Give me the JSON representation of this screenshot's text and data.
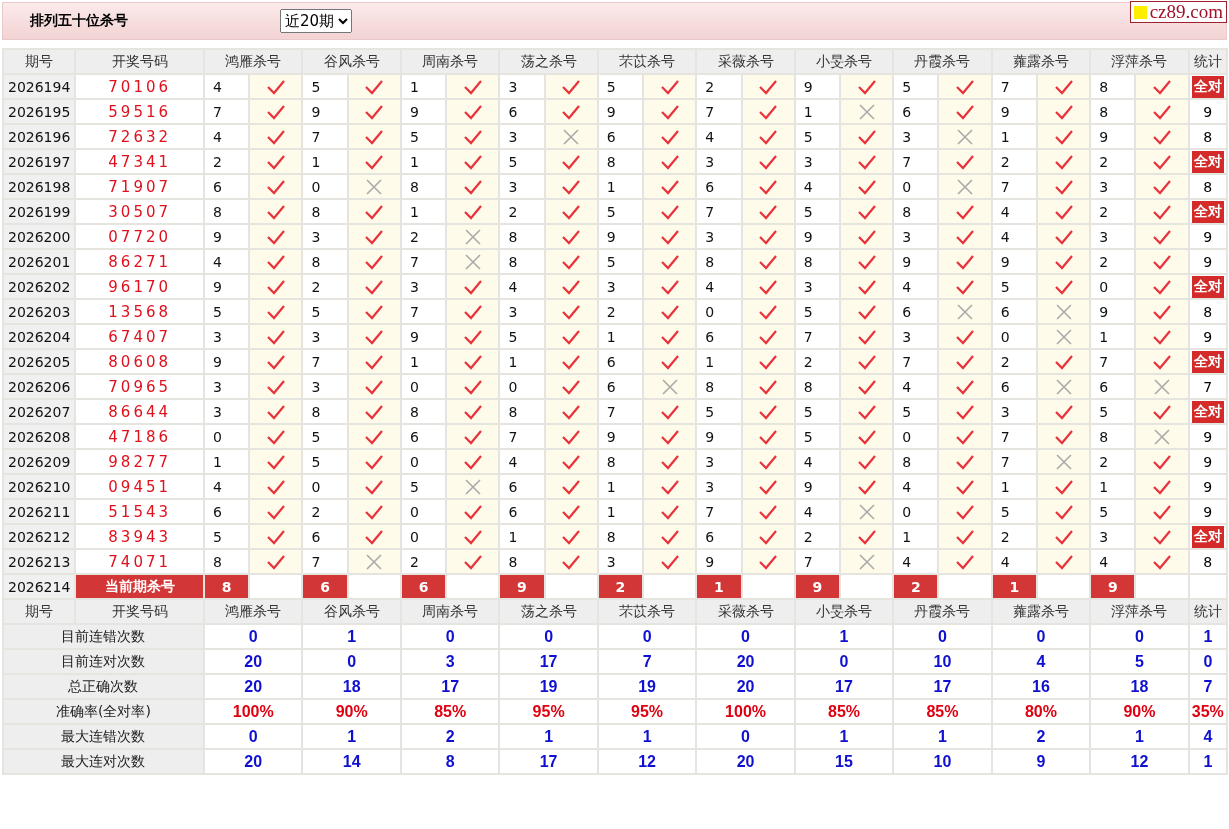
{
  "header": {
    "title": "排列五十位杀号",
    "period_select": "近20期",
    "logo": "cz89.com"
  },
  "columns": [
    "期号",
    "开奖号码",
    "鸿雁杀号",
    "谷风杀号",
    "周南杀号",
    "荡之杀号",
    "芣苡杀号",
    "采薇杀号",
    "小旻杀号",
    "丹霞杀号",
    "蕹露杀号",
    "浮萍杀号",
    "统计"
  ],
  "rows": [
    {
      "period": "2026194",
      "draw": "70106",
      "picks": [
        [
          "4",
          true
        ],
        [
          "5",
          true
        ],
        [
          "1",
          true
        ],
        [
          "3",
          true
        ],
        [
          "5",
          true
        ],
        [
          "2",
          true
        ],
        [
          "9",
          true
        ],
        [
          "5",
          true
        ],
        [
          "7",
          true
        ],
        [
          "8",
          true
        ]
      ],
      "stat": "全对",
      "full": true
    },
    {
      "period": "2026195",
      "draw": "59516",
      "picks": [
        [
          "7",
          true
        ],
        [
          "9",
          true
        ],
        [
          "9",
          true
        ],
        [
          "6",
          true
        ],
        [
          "9",
          true
        ],
        [
          "7",
          true
        ],
        [
          "1",
          false
        ],
        [
          "6",
          true
        ],
        [
          "9",
          true
        ],
        [
          "8",
          true
        ]
      ],
      "stat": "9",
      "full": false
    },
    {
      "period": "2026196",
      "draw": "72632",
      "picks": [
        [
          "4",
          true
        ],
        [
          "7",
          true
        ],
        [
          "5",
          true
        ],
        [
          "3",
          false
        ],
        [
          "6",
          true
        ],
        [
          "4",
          true
        ],
        [
          "5",
          true
        ],
        [
          "3",
          false
        ],
        [
          "1",
          true
        ],
        [
          "9",
          true
        ]
      ],
      "stat": "8",
      "full": false
    },
    {
      "period": "2026197",
      "draw": "47341",
      "picks": [
        [
          "2",
          true
        ],
        [
          "1",
          true
        ],
        [
          "1",
          true
        ],
        [
          "5",
          true
        ],
        [
          "8",
          true
        ],
        [
          "3",
          true
        ],
        [
          "3",
          true
        ],
        [
          "7",
          true
        ],
        [
          "2",
          true
        ],
        [
          "2",
          true
        ]
      ],
      "stat": "全对",
      "full": true
    },
    {
      "period": "2026198",
      "draw": "71907",
      "picks": [
        [
          "6",
          true
        ],
        [
          "0",
          false
        ],
        [
          "8",
          true
        ],
        [
          "3",
          true
        ],
        [
          "1",
          true
        ],
        [
          "6",
          true
        ],
        [
          "4",
          true
        ],
        [
          "0",
          false
        ],
        [
          "7",
          true
        ],
        [
          "3",
          true
        ]
      ],
      "stat": "8",
      "full": false
    },
    {
      "period": "2026199",
      "draw": "30507",
      "picks": [
        [
          "8",
          true
        ],
        [
          "8",
          true
        ],
        [
          "1",
          true
        ],
        [
          "2",
          true
        ],
        [
          "5",
          true
        ],
        [
          "7",
          true
        ],
        [
          "5",
          true
        ],
        [
          "8",
          true
        ],
        [
          "4",
          true
        ],
        [
          "2",
          true
        ]
      ],
      "stat": "全对",
      "full": true
    },
    {
      "period": "2026200",
      "draw": "07720",
      "picks": [
        [
          "9",
          true
        ],
        [
          "3",
          true
        ],
        [
          "2",
          false
        ],
        [
          "8",
          true
        ],
        [
          "9",
          true
        ],
        [
          "3",
          true
        ],
        [
          "9",
          true
        ],
        [
          "3",
          true
        ],
        [
          "4",
          true
        ],
        [
          "3",
          true
        ]
      ],
      "stat": "9",
      "full": false
    },
    {
      "period": "2026201",
      "draw": "86271",
      "picks": [
        [
          "4",
          true
        ],
        [
          "8",
          true
        ],
        [
          "7",
          false
        ],
        [
          "8",
          true
        ],
        [
          "5",
          true
        ],
        [
          "8",
          true
        ],
        [
          "8",
          true
        ],
        [
          "9",
          true
        ],
        [
          "9",
          true
        ],
        [
          "2",
          true
        ]
      ],
      "stat": "9",
      "full": false
    },
    {
      "period": "2026202",
      "draw": "96170",
      "picks": [
        [
          "9",
          true
        ],
        [
          "2",
          true
        ],
        [
          "3",
          true
        ],
        [
          "4",
          true
        ],
        [
          "3",
          true
        ],
        [
          "4",
          true
        ],
        [
          "3",
          true
        ],
        [
          "4",
          true
        ],
        [
          "5",
          true
        ],
        [
          "0",
          true
        ]
      ],
      "stat": "全对",
      "full": true
    },
    {
      "period": "2026203",
      "draw": "13568",
      "picks": [
        [
          "5",
          true
        ],
        [
          "5",
          true
        ],
        [
          "7",
          true
        ],
        [
          "3",
          true
        ],
        [
          "2",
          true
        ],
        [
          "0",
          true
        ],
        [
          "5",
          true
        ],
        [
          "6",
          false
        ],
        [
          "6",
          false
        ],
        [
          "9",
          true
        ]
      ],
      "stat": "8",
      "full": false
    },
    {
      "period": "2026204",
      "draw": "67407",
      "picks": [
        [
          "3",
          true
        ],
        [
          "3",
          true
        ],
        [
          "9",
          true
        ],
        [
          "5",
          true
        ],
        [
          "1",
          true
        ],
        [
          "6",
          true
        ],
        [
          "7",
          true
        ],
        [
          "3",
          true
        ],
        [
          "0",
          false
        ],
        [
          "1",
          true
        ]
      ],
      "stat": "9",
      "full": false
    },
    {
      "period": "2026205",
      "draw": "80608",
      "picks": [
        [
          "9",
          true
        ],
        [
          "7",
          true
        ],
        [
          "1",
          true
        ],
        [
          "1",
          true
        ],
        [
          "6",
          true
        ],
        [
          "1",
          true
        ],
        [
          "2",
          true
        ],
        [
          "7",
          true
        ],
        [
          "2",
          true
        ],
        [
          "7",
          true
        ]
      ],
      "stat": "全对",
      "full": true
    },
    {
      "period": "2026206",
      "draw": "70965",
      "picks": [
        [
          "3",
          true
        ],
        [
          "3",
          true
        ],
        [
          "0",
          true
        ],
        [
          "0",
          true
        ],
        [
          "6",
          false
        ],
        [
          "8",
          true
        ],
        [
          "8",
          true
        ],
        [
          "4",
          true
        ],
        [
          "6",
          false
        ],
        [
          "6",
          false
        ]
      ],
      "stat": "7",
      "full": false
    },
    {
      "period": "2026207",
      "draw": "86644",
      "picks": [
        [
          "3",
          true
        ],
        [
          "8",
          true
        ],
        [
          "8",
          true
        ],
        [
          "8",
          true
        ],
        [
          "7",
          true
        ],
        [
          "5",
          true
        ],
        [
          "5",
          true
        ],
        [
          "5",
          true
        ],
        [
          "3",
          true
        ],
        [
          "5",
          true
        ]
      ],
      "stat": "全对",
      "full": true
    },
    {
      "period": "2026208",
      "draw": "47186",
      "picks": [
        [
          "0",
          true
        ],
        [
          "5",
          true
        ],
        [
          "6",
          true
        ],
        [
          "7",
          true
        ],
        [
          "9",
          true
        ],
        [
          "9",
          true
        ],
        [
          "5",
          true
        ],
        [
          "0",
          true
        ],
        [
          "7",
          true
        ],
        [
          "8",
          false
        ]
      ],
      "stat": "9",
      "full": false
    },
    {
      "period": "2026209",
      "draw": "98277",
      "picks": [
        [
          "1",
          true
        ],
        [
          "5",
          true
        ],
        [
          "0",
          true
        ],
        [
          "4",
          true
        ],
        [
          "8",
          true
        ],
        [
          "3",
          true
        ],
        [
          "4",
          true
        ],
        [
          "8",
          true
        ],
        [
          "7",
          false
        ],
        [
          "2",
          true
        ]
      ],
      "stat": "9",
      "full": false
    },
    {
      "period": "2026210",
      "draw": "09451",
      "picks": [
        [
          "4",
          true
        ],
        [
          "0",
          true
        ],
        [
          "5",
          false
        ],
        [
          "6",
          true
        ],
        [
          "1",
          true
        ],
        [
          "3",
          true
        ],
        [
          "9",
          true
        ],
        [
          "4",
          true
        ],
        [
          "1",
          true
        ],
        [
          "1",
          true
        ]
      ],
      "stat": "9",
      "full": false
    },
    {
      "period": "2026211",
      "draw": "51543",
      "picks": [
        [
          "6",
          true
        ],
        [
          "2",
          true
        ],
        [
          "0",
          true
        ],
        [
          "6",
          true
        ],
        [
          "1",
          true
        ],
        [
          "7",
          true
        ],
        [
          "4",
          false
        ],
        [
          "0",
          true
        ],
        [
          "5",
          true
        ],
        [
          "5",
          true
        ]
      ],
      "stat": "9",
      "full": false
    },
    {
      "period": "2026212",
      "draw": "83943",
      "picks": [
        [
          "5",
          true
        ],
        [
          "6",
          true
        ],
        [
          "0",
          true
        ],
        [
          "1",
          true
        ],
        [
          "8",
          true
        ],
        [
          "6",
          true
        ],
        [
          "2",
          true
        ],
        [
          "1",
          true
        ],
        [
          "2",
          true
        ],
        [
          "3",
          true
        ]
      ],
      "stat": "全对",
      "full": true
    },
    {
      "period": "2026213",
      "draw": "74071",
      "picks": [
        [
          "8",
          true
        ],
        [
          "7",
          false
        ],
        [
          "2",
          true
        ],
        [
          "8",
          true
        ],
        [
          "3",
          true
        ],
        [
          "9",
          true
        ],
        [
          "7",
          false
        ],
        [
          "4",
          true
        ],
        [
          "4",
          true
        ],
        [
          "4",
          true
        ]
      ],
      "stat": "8",
      "full": false
    }
  ],
  "current": {
    "period": "2026214",
    "label": "当前期杀号",
    "picks": [
      "8",
      "6",
      "6",
      "9",
      "2",
      "1",
      "9",
      "2",
      "1",
      "9"
    ]
  },
  "footer_columns": [
    "期号",
    "开奖号码",
    "鸿雁杀号",
    "谷风杀号",
    "周南杀号",
    "荡之杀号",
    "芣苡杀号",
    "采薇杀号",
    "小旻杀号",
    "丹霞杀号",
    "蕹露杀号",
    "浮萍杀号",
    "统计"
  ],
  "summary": [
    {
      "label": "目前连错次数",
      "kind": "count",
      "values": [
        "0",
        "1",
        "0",
        "0",
        "0",
        "0",
        "1",
        "0",
        "0",
        "0",
        "1"
      ]
    },
    {
      "label": "目前连对次数",
      "kind": "count",
      "values": [
        "20",
        "0",
        "3",
        "17",
        "7",
        "20",
        "0",
        "10",
        "4",
        "5",
        "0"
      ]
    },
    {
      "label": "总正确次数",
      "kind": "count",
      "values": [
        "20",
        "18",
        "17",
        "19",
        "19",
        "20",
        "17",
        "17",
        "16",
        "18",
        "7"
      ]
    },
    {
      "label": "准确率(全对率)",
      "kind": "rate",
      "values": [
        "100%",
        "90%",
        "85%",
        "95%",
        "95%",
        "100%",
        "85%",
        "85%",
        "80%",
        "90%",
        "35%"
      ]
    },
    {
      "label": "最大连错次数",
      "kind": "count",
      "values": [
        "0",
        "1",
        "2",
        "1",
        "1",
        "0",
        "1",
        "1",
        "2",
        "1",
        "4"
      ]
    },
    {
      "label": "最大连对次数",
      "kind": "count",
      "values": [
        "20",
        "14",
        "8",
        "17",
        "12",
        "20",
        "15",
        "10",
        "9",
        "12",
        "1"
      ]
    }
  ]
}
